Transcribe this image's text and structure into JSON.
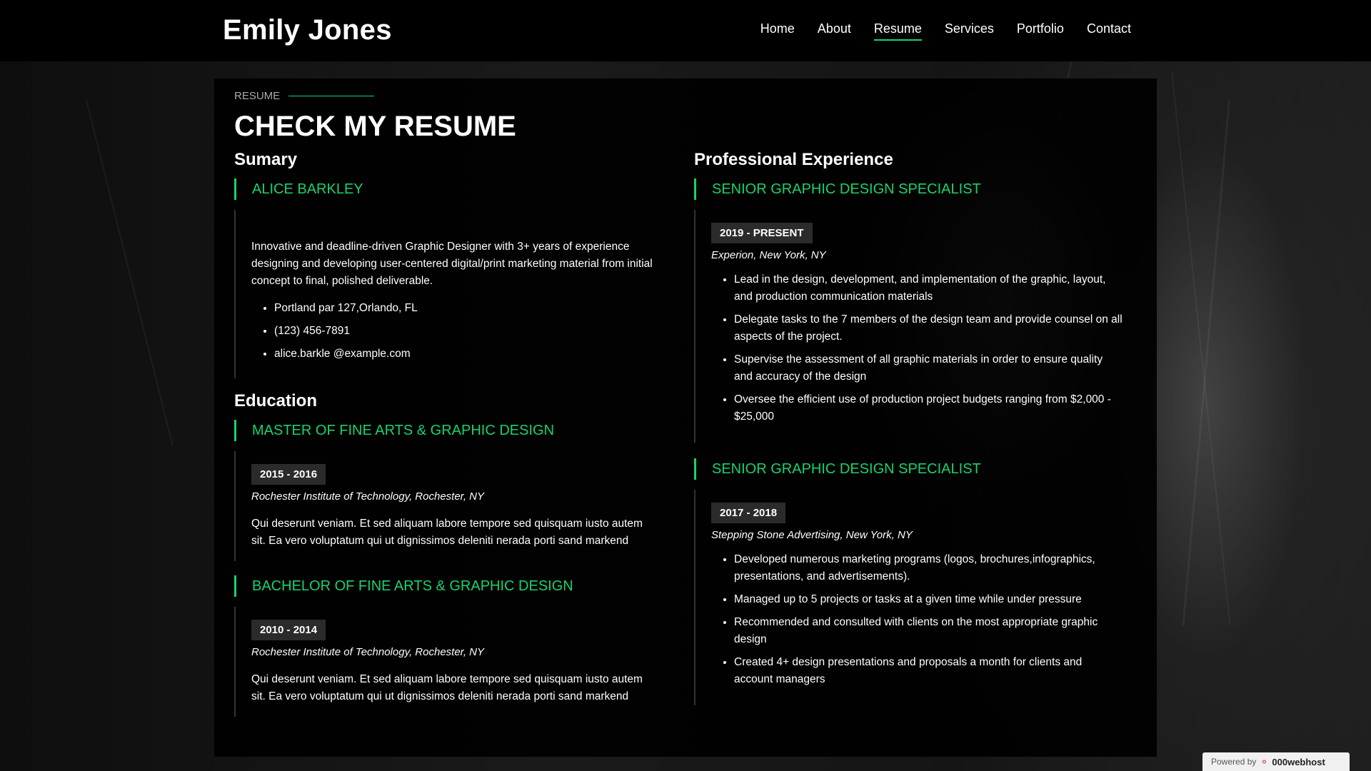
{
  "site": {
    "name": "Emily Jones"
  },
  "nav": {
    "items": [
      "Home",
      "About",
      "Resume",
      "Services",
      "Portfolio",
      "Contact"
    ],
    "active": "Resume"
  },
  "resume": {
    "label": "Resume",
    "title": "CHECK MY RESUME",
    "summary": {
      "heading": "Sumary",
      "name": "ALICE BARKLEY",
      "description": "Innovative and deadline-driven Graphic Designer with 3+ years of experience designing and developing user-centered digital/print marketing material from initial concept to final, polished deliverable.",
      "contacts": [
        "Portland par 127,Orlando, FL",
        "(123) 456-7891",
        "alice.barkle @example.com"
      ]
    },
    "education": {
      "heading": "Education",
      "items": [
        {
          "title": "MASTER OF FINE ARTS & GRAPHIC DESIGN",
          "period": "2015 - 2016",
          "place": "Rochester Institute of Technology, Rochester, NY",
          "description": "Qui deserunt veniam. Et sed aliquam labore tempore sed quisquam iusto autem sit. Ea vero voluptatum qui ut dignissimos deleniti nerada porti sand markend"
        },
        {
          "title": "BACHELOR OF FINE ARTS & GRAPHIC DESIGN",
          "period": "2010 - 2014",
          "place": "Rochester Institute of Technology, Rochester, NY",
          "description": "Qui deserunt veniam. Et sed aliquam labore tempore sed quisquam iusto autem sit. Ea vero voluptatum qui ut dignissimos deleniti nerada porti sand markend"
        }
      ]
    },
    "experience": {
      "heading": "Professional Experience",
      "items": [
        {
          "title": "SENIOR GRAPHIC DESIGN SPECIALIST",
          "period": "2019 - PRESENT",
          "place": "Experion, New York, NY",
          "bullets": [
            "Lead in the design, development, and implementation of the graphic, layout, and production communication materials",
            "Delegate tasks to the 7 members of the design team and provide counsel on all aspects of the project.",
            "Supervise the assessment of all graphic materials in order to ensure quality and accuracy of the design",
            "Oversee the efficient use of production project budgets ranging from $2,000 - $25,000"
          ]
        },
        {
          "title": "SENIOR GRAPHIC DESIGN SPECIALIST",
          "period": "2017 - 2018",
          "place": "Stepping Stone Advertising, New York, NY",
          "bullets": [
            "Developed numerous marketing programs (logos, brochures,infographics, presentations, and advertisements).",
            "Managed up to 5 projects or tasks at a given time while under pressure",
            "Recommended and consulted with clients on the most appropriate graphic design",
            "Created 4+ design presentations and proposals a month for clients and account managers"
          ]
        }
      ]
    }
  },
  "badge": {
    "prefix": "Powered by",
    "brand": "000webhost"
  },
  "colors": {
    "accent": "#18d26e",
    "background": "#000000",
    "period_bg": "#2b2b2b"
  },
  "icons": {
    "badge_logo": "swirl-logo-icon"
  }
}
